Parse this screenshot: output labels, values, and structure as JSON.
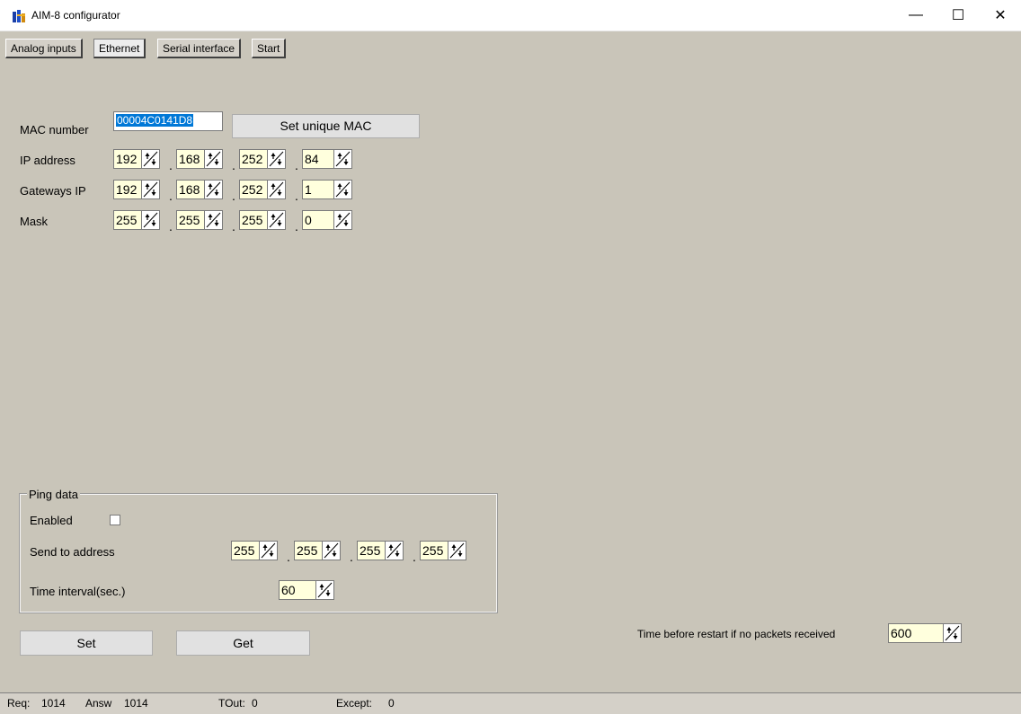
{
  "window": {
    "title": "AIM-8 configurator",
    "icon": "aim8-app-icon",
    "minimize_glyph": "—",
    "maximize_glyph": "☐",
    "close_glyph": "✕"
  },
  "tabs": [
    {
      "label": "Analog inputs",
      "active": false
    },
    {
      "label": "Ethernet",
      "active": true
    },
    {
      "label": "Serial interface",
      "active": false
    },
    {
      "label": "Start",
      "active": false
    }
  ],
  "ethernet": {
    "mac_label": "MAC number",
    "mac_value": "00004C0141D8",
    "set_unique_mac_label": "Set unique MAC",
    "ip_label": "IP address",
    "ip": [
      "192",
      "168",
      "252",
      "84"
    ],
    "gateway_label": "Gateways IP",
    "gateway": [
      "192",
      "168",
      "252",
      "1"
    ],
    "mask_label": "Mask",
    "mask": [
      "255",
      "255",
      "255",
      "0"
    ]
  },
  "ping": {
    "group_title": "Ping data",
    "enabled_label": "Enabled",
    "enabled": false,
    "send_to_label": "Send to address",
    "send_to": [
      "255",
      "255",
      "255",
      "255"
    ],
    "interval_label": "Time interval(sec.)",
    "interval": "60"
  },
  "actions": {
    "set_label": "Set",
    "get_label": "Get"
  },
  "restart": {
    "label": "Time before restart if no packets received",
    "value": "600"
  },
  "status": {
    "req_label": "Req:",
    "req_value": "1014",
    "answ_label": "Answ",
    "answ_value": "1014",
    "tout_label": "TOut:",
    "tout_value": "0",
    "except_label": "Except:",
    "except_value": "0"
  }
}
